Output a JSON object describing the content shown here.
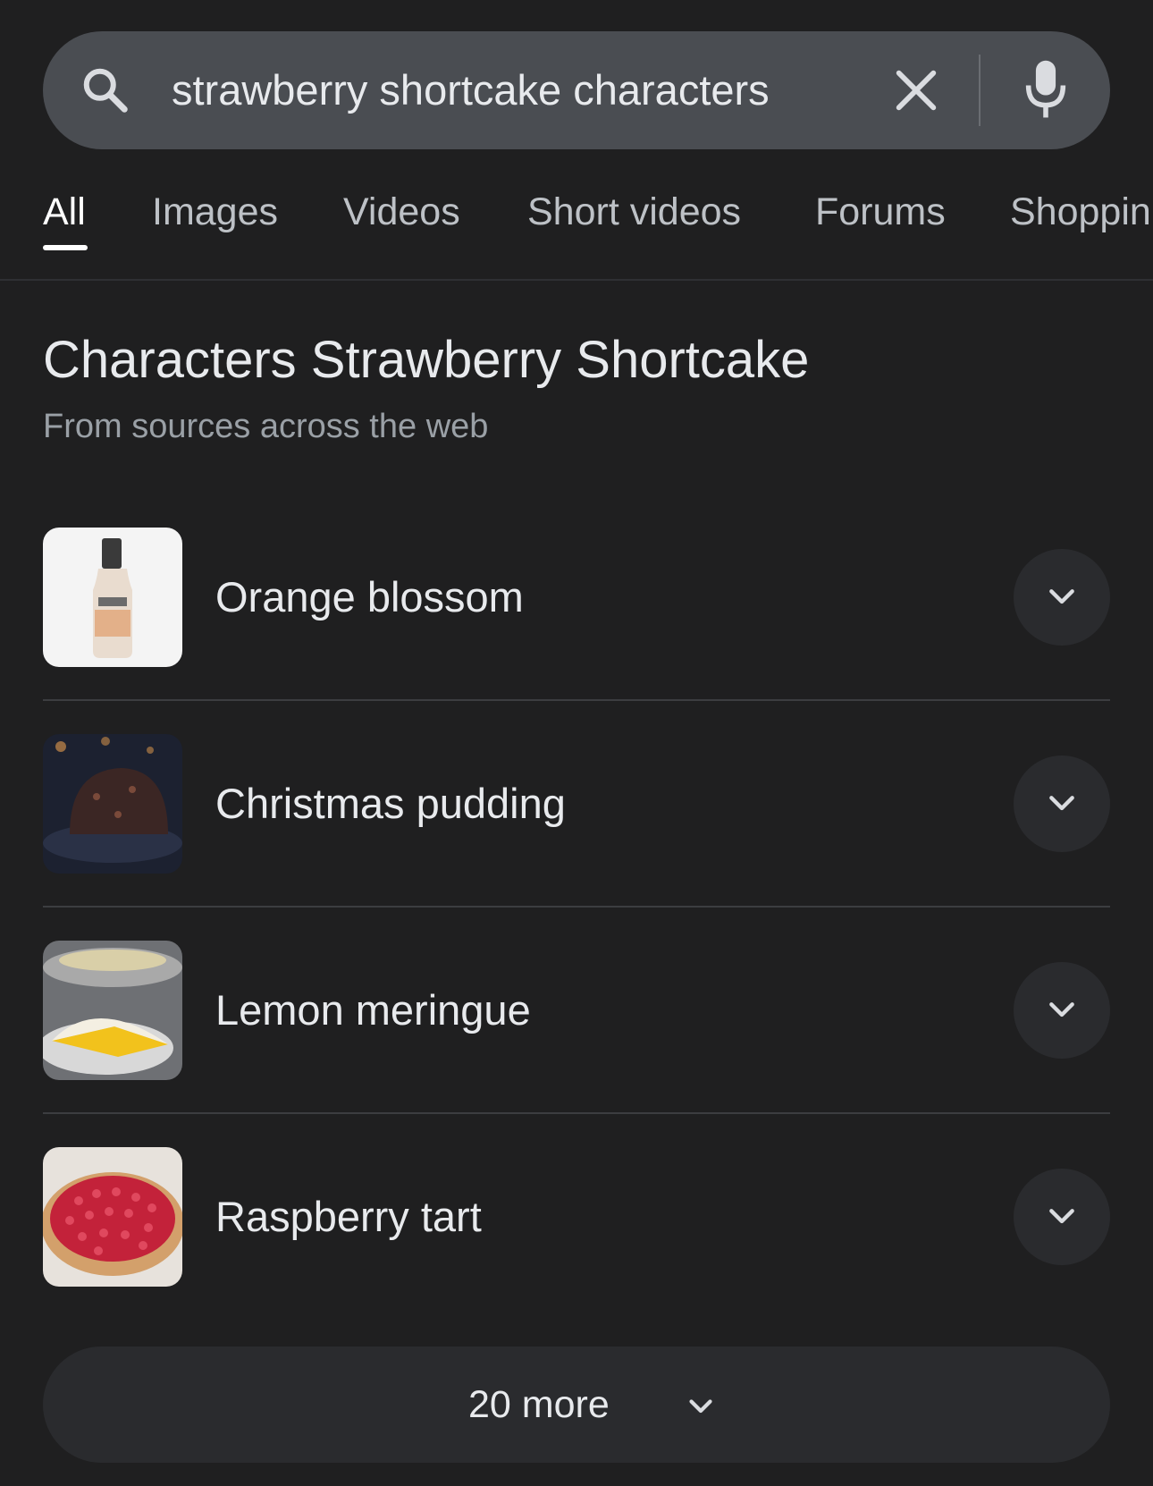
{
  "search": {
    "query": "strawberry shortcake characters"
  },
  "tabs": [
    {
      "label": "All",
      "active": true
    },
    {
      "label": "Images",
      "active": false
    },
    {
      "label": "Videos",
      "active": false
    },
    {
      "label": "Short videos",
      "active": false
    },
    {
      "label": "Forums",
      "active": false
    },
    {
      "label": "Shoppin",
      "active": false
    }
  ],
  "section": {
    "title": "Characters Strawberry Shortcake",
    "subtitle": "From sources across the web"
  },
  "items": [
    {
      "label": "Orange blossom",
      "thumb_icon": "bottle-image"
    },
    {
      "label": "Christmas pudding",
      "thumb_icon": "pudding-image"
    },
    {
      "label": "Lemon meringue",
      "thumb_icon": "pie-image"
    },
    {
      "label": "Raspberry tart",
      "thumb_icon": "tart-image"
    }
  ],
  "more": {
    "label": "20 more"
  },
  "colors": {
    "background": "#1f1f20",
    "search_bar": "#4a4d52",
    "button_bg": "#2a2b2e",
    "text_primary": "#e8eaed",
    "text_secondary": "#9aa0a6"
  }
}
